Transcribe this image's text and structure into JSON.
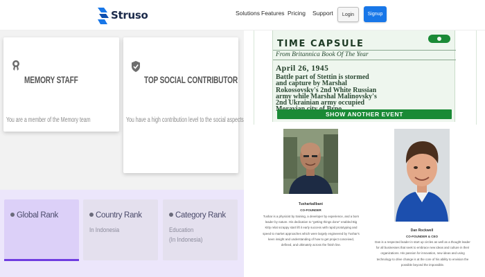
{
  "header": {
    "brand": "Struso",
    "nav": [
      "Solutions",
      "Features",
      "Pricing",
      "Support"
    ],
    "login_label": "Login",
    "signup_label": "Signup",
    "brand_color": "#1877e8"
  },
  "badges": [
    {
      "title": "MEMORY STAFF",
      "description": "You are a member of the Memory team",
      "icon": "badge-medal-icon"
    },
    {
      "title": "TOP SOCIAL CONTRIBUTOR",
      "description": "You have a high contribution level to the social aspects",
      "icon": "badge-shield-check-icon"
    }
  ],
  "ranks": [
    {
      "title": "Global Rank",
      "lines": [],
      "active": true
    },
    {
      "title": "Country Rank",
      "lines": [
        "In Indonesia"
      ],
      "active": false
    },
    {
      "title": "Category Rank",
      "lines": [
        "Education",
        "(In Indonesia)"
      ],
      "active": false
    }
  ],
  "capsule": {
    "title": "TIME CAPSULE",
    "subtitle": "From Britannica Book Of The Year",
    "date": "April 26, 1945",
    "lines": [
      "Battle part of Stettin is stormed",
      "and capture by Marshal",
      "Rokossovsky's 2nd White Russian",
      "army while Marshal Malinovsky's",
      "2nd Ukrainian army occupied",
      "Moravian city of Brno."
    ],
    "button_label": "SHOW ANOTHER EVENT",
    "accent": "#1a8a36"
  },
  "team": [
    {
      "name": "Tusharkallbani",
      "role": "CO-FOUNDER",
      "bio": [
        "Tushar is a physicist by training, a developer by experience, and a born",
        "leader by nature. His dedication to \"getting things done\" enabled Big",
        "Kitty relat scrappy start lift it early success with rapid prototyping and",
        "speed to market approaches which were largely engineered by Tushar's",
        "keen insight and understanding of how to get project conceived,",
        "defined, and ultimately across the finish line."
      ]
    },
    {
      "name": "Dan Rockwell",
      "role": "CO-FOUNDER & CEO",
      "bio": [
        "Dan is a respected leader in start up circles as well as a thought leader",
        "for all businesses that seek to embrace new ideas and culture in their",
        "organizations. His passion for innovation, new ideas and using",
        "technology to drive change is at the core of his ability to envision the",
        "possible beyond the impossible."
      ]
    }
  ]
}
